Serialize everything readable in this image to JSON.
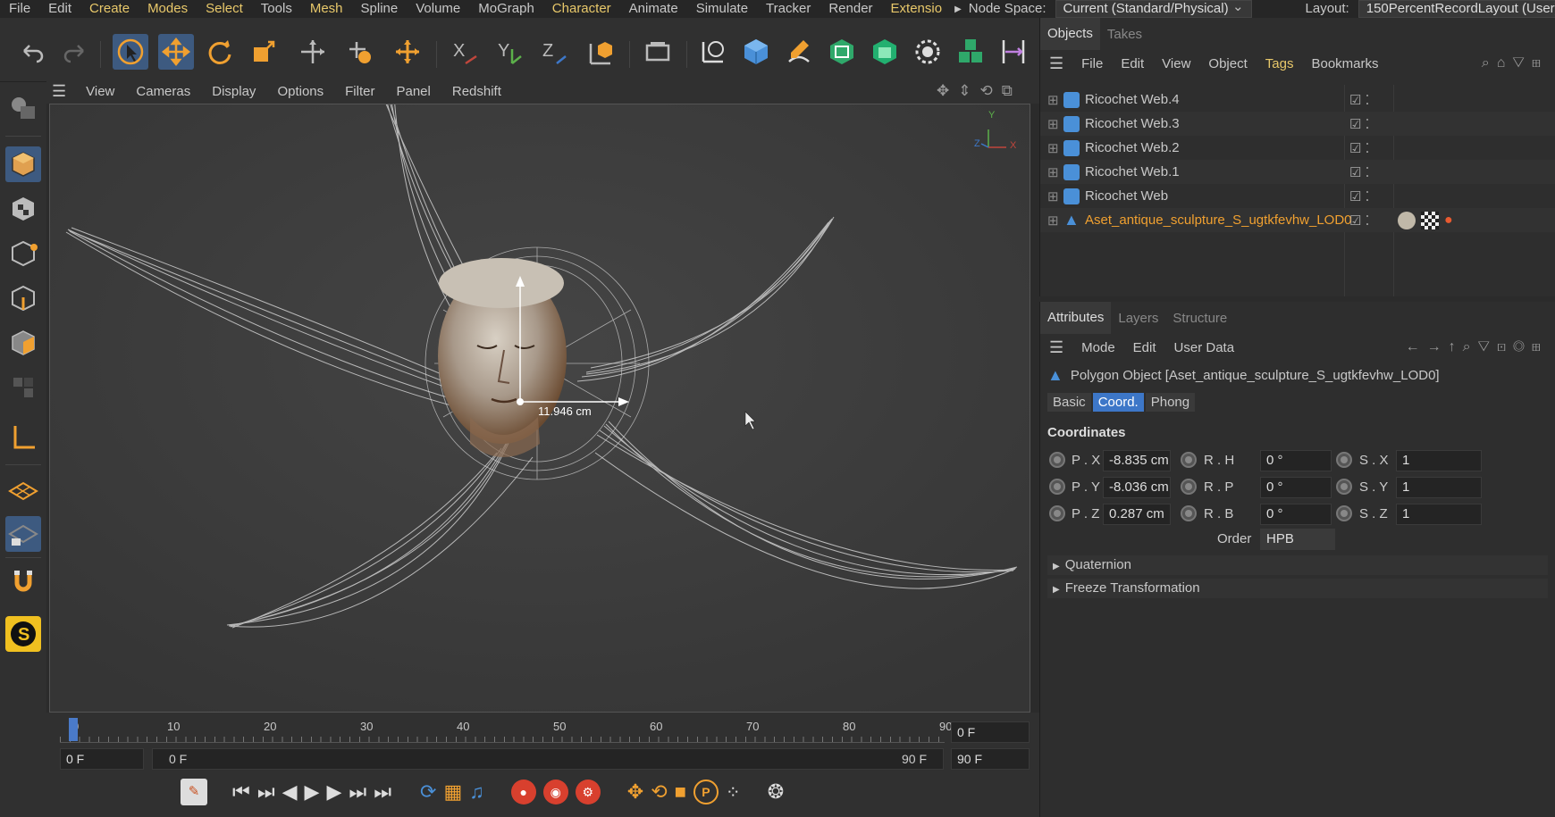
{
  "menubar": {
    "items": [
      "File",
      "Edit",
      "Create",
      "Modes",
      "Select",
      "Tools",
      "Mesh",
      "Spline",
      "Volume",
      "MoGraph",
      "Character",
      "Animate",
      "Simulate",
      "Tracker",
      "Render",
      "Extensio"
    ],
    "highlighted": [
      2,
      3,
      4,
      6,
      10,
      15
    ],
    "node_space_label": "Node Space:",
    "node_space_value": "Current (Standard/Physical)",
    "layout_label": "Layout:",
    "layout_value": "150PercentRecordLayout (User)"
  },
  "viewport_menu": {
    "items": [
      "View",
      "Cameras",
      "Display",
      "Options",
      "Filter",
      "Panel",
      "Redshift"
    ]
  },
  "viewport": {
    "measure_label": "11.946 cm",
    "axis_y": "Y",
    "axis_z": "Z",
    "axis_x": "X"
  },
  "timeline": {
    "ticks": [
      "0",
      "10",
      "20",
      "30",
      "40",
      "50",
      "60",
      "70",
      "80",
      "90"
    ],
    "current_frame": "0 F",
    "start_frame": "0 F",
    "range_start": "0 F",
    "range_end": "90 F",
    "end_frame": "90 F"
  },
  "objects_panel": {
    "tabs": [
      "Objects",
      "Takes"
    ],
    "menu": [
      "File",
      "Edit",
      "View",
      "Object",
      "Tags",
      "Bookmarks"
    ],
    "objects": [
      {
        "name": "Ricochet Web.4",
        "color": "#d8d8d8"
      },
      {
        "name": "Ricochet Web.3",
        "color": "#d8d8d8"
      },
      {
        "name": "Ricochet Web.2",
        "color": "#d8d8d8"
      },
      {
        "name": "Ricochet Web.1",
        "color": "#d8d8d8"
      },
      {
        "name": "Ricochet Web",
        "color": "#d8d8d8"
      },
      {
        "name": "Aset_antique_sculpture_S_ugtkfevhw_LOD0",
        "color": "#f0a030"
      }
    ]
  },
  "attributes_panel": {
    "tabs": [
      "Attributes",
      "Layers",
      "Structure"
    ],
    "menu": [
      "Mode",
      "Edit",
      "User Data"
    ],
    "object_title": "Polygon Object [Aset_antique_sculpture_S_ugtkfevhw_LOD0]",
    "subtabs": [
      "Basic",
      "Coord.",
      "Phong"
    ],
    "active_subtab": "Coord.",
    "section": "Coordinates",
    "coords": [
      {
        "plabel": "P . X",
        "pval": "-8.835 cm",
        "rlabel": "R . H",
        "rval": "0 °",
        "slabel": "S . X",
        "sval": "1"
      },
      {
        "plabel": "P . Y",
        "pval": "-8.036 cm",
        "rlabel": "R . P",
        "rval": "0 °",
        "slabel": "S . Y",
        "sval": "1"
      },
      {
        "plabel": "P . Z",
        "pval": "0.287 cm",
        "rlabel": "R . B",
        "rval": "0 °",
        "slabel": "S . Z",
        "sval": "1"
      }
    ],
    "order_label": "Order",
    "order_value": "HPB",
    "collapsibles": [
      "Quaternion",
      "Freeze Transformation"
    ]
  },
  "colors": {
    "accent_blue": "#3d77c8",
    "highlight_orange": "#f0a030",
    "menu_yellow": "#e8c86a"
  }
}
